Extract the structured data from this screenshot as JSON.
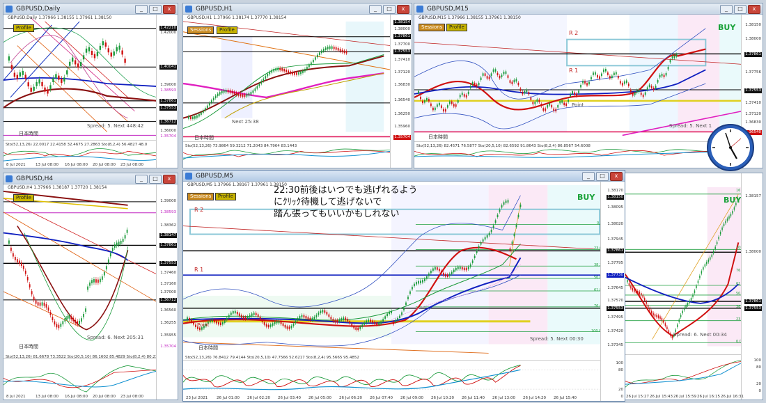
{
  "windows": {
    "daily": {
      "title": "GBPUSD,Daily",
      "symbol_line": "GBPUSD,Daily 1.37966 1.38155 1.37961 1.38150",
      "profile": "Profile",
      "prices": [
        "1.42210",
        "1.42000",
        "1.40041",
        "1.39000",
        "1.38593",
        "1.37861",
        "1.37553",
        "1.36712",
        "1.36000",
        "1.35704"
      ],
      "spread_text": "Spread: 5. Next 448:42",
      "japan_label": "日本時間",
      "osc_label": "Sto(52,13,26) 22.0017 22.4158 32.4675 27.2863 Sto(8,2,4) 56.4827 48.0",
      "times": [
        "8 Jul 2021",
        "13 Jul 08:00",
        "16 Jul 08:00",
        "20 Jul 08:00",
        "23 Jul 08:00"
      ]
    },
    "h1": {
      "title": "GBPUSD,H1",
      "symbol_line": "GBPUSD,H1 1.37966 1.38174 1.37770 1.38154",
      "sessions": "Sessions",
      "profile": "Profile",
      "prices": [
        "1.38154",
        "1.38000",
        "1.37861",
        "1.37700",
        "1.37553",
        "1.37410",
        "1.37120",
        "1.36830",
        "1.36540",
        "1.36250",
        "1.35960",
        "1.35704"
      ],
      "next_text": "Next 25:38",
      "japan_label": "日本時間",
      "osc_label": "Sto(52,13,26) 73.9864 59.3212 71.2043 84.7964 83.1443"
    },
    "m15": {
      "title": "GBPUSD,M15",
      "symbol_line": "GBPUSD,M15 1.37966 1.38155 1.37961 1.38150",
      "sessions": "Sessions",
      "profile": "Profile",
      "buy": "BUY",
      "r2": "R 2",
      "r1": "R 1",
      "point_label": "Point",
      "prices": [
        "1.38150",
        "1.38000",
        "1.37861",
        "1.37756",
        "1.37553",
        "1.37410",
        "1.37120",
        "1.36830",
        "1.36540"
      ],
      "spread_text": "Spread: 5. Next 1",
      "japan_label": "日本時間",
      "osc_label": "Sto(52,13,26) 82.4571 76.5877 Sto(20,5,10) 82.6592 91.8643 Sto(8,2,4) 86.8567 54.6008"
    },
    "h4": {
      "title": "GBPUSD,H4",
      "symbol_line": "GBPUSD,H4 1.37966 1.38187 1.37720 1.38154",
      "profile": "Profile",
      "prices": [
        "1.39000",
        "1.38593",
        "1.38362",
        "1.38147",
        "1.37861",
        "1.37553",
        "1.37460",
        "1.37160",
        "1.37000",
        "1.36712",
        "1.36560",
        "1.36255",
        "1.35955",
        "1.35704"
      ],
      "spread_text": "Spread: 6. Next 205:31",
      "japan_label": "日本時間",
      "osc_label": "Sto(52,13,26) 81.6678 73.3522 Sto(20,5,10) 86.1602 85.4829 Sto(8,2,4) 80.2381 72.81",
      "times": [
        "8 Jul 2021",
        "13 Jul 08:00",
        "16 Jul 08:00",
        "20 Jul 08:00",
        "23 Jul 08:00"
      ]
    },
    "m5": {
      "title": "GBPUSD,M5",
      "symbol_line": "GBPUSD,M5 1.37966 1.38167 1.37961 1.38150",
      "sessions": "Sessions",
      "profile": "Profile",
      "buy": "BUY",
      "r2": "R 2",
      "r1": "R 1",
      "point_label": "Point",
      "fib_levels": [
        "0.0",
        "23.6",
        "38.2",
        "50.0",
        "61.8",
        "76.4",
        "100.0"
      ],
      "prices": [
        "1.38170",
        "1.38150",
        "1.38095",
        "1.38020",
        "1.37945",
        "1.37861",
        "1.37795",
        "1.37730",
        "1.37645",
        "1.37570",
        "1.37553",
        "1.37495",
        "1.37420",
        "1.37345"
      ],
      "spread_text": "Spread: 5. Next 00:30",
      "japan_label": "日本時間",
      "osc_label": "Sto(52,13,26) 76.8412 79.4144 Sto(20,5,10) 47.7566 52.6217 Sto(8,2,4) 95.5665 95.4852",
      "osc_scale": [
        "100",
        "80",
        "20",
        "0"
      ],
      "times": [
        "23 Jul 2021",
        "26 Jul 01:00",
        "26 Jul 02:20",
        "26 Jul 03:40",
        "26 Jul 05:00",
        "26 Jul 06:20",
        "26 Jul 07:40",
        "26 Jul 09:00",
        "26 Jul 10:20",
        "26 Jul 11:40",
        "26 Jul 13:00",
        "26 Jul 14:20",
        "26 Jul 15:40"
      ]
    },
    "m1": {
      "buy": "BUY",
      "fib_levels": [
        "161.8",
        "100.0",
        "76.4",
        "61.8",
        "50.0",
        "38.2",
        "23.6",
        "0.0"
      ],
      "prices": [
        "1.38157",
        "1.38000",
        "1.37861",
        "1.37553"
      ],
      "spread_text": "Spread: 6. Next 00:34",
      "times": [
        "26 Jul 15:27",
        "26 Jul 15:43",
        "26 Jul 15:59",
        "26 Jul 16:15",
        "26 Jul 16:31"
      ],
      "osc_scale": [
        "100",
        "80",
        "20",
        "0"
      ]
    }
  },
  "annotation": {
    "lines": [
      "22:30前後はいつでも逃げれるよう",
      "にｸﾘｯｸ待機して逃げないで",
      "踏ん張ってもいいかもしれない"
    ]
  },
  "colors": {
    "bg": "#c9d3de",
    "bull": "#1a9a3a",
    "bear": "#d01010",
    "buy": "#1aa23a",
    "sessions_tag": "#c98a1f",
    "profile_tag": "#c8b400"
  },
  "window_buttons": {
    "minimize": "_",
    "maximize": "□",
    "close": "x"
  }
}
